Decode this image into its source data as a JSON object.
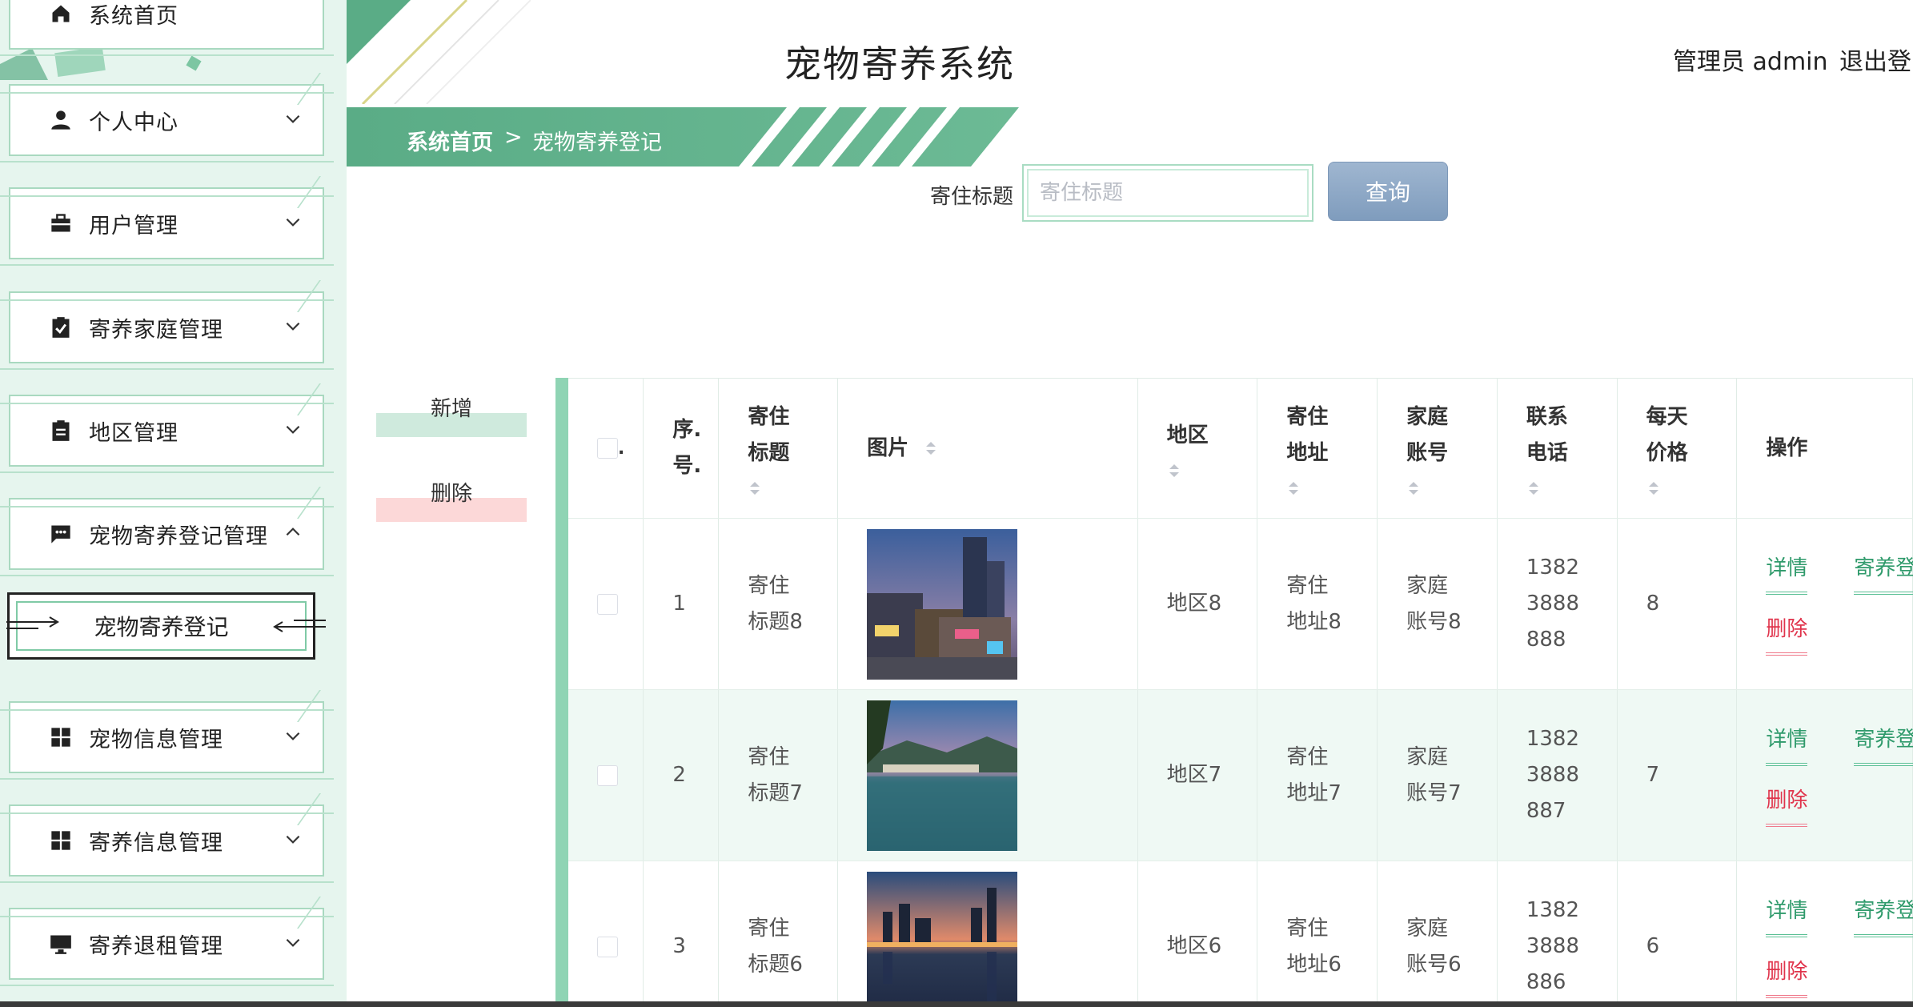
{
  "header": {
    "title": "宠物寄养系统",
    "admin_label": "管理员 admin",
    "logout_label": "退出登"
  },
  "breadcrumb": {
    "home": "系统首页",
    "separator": ">",
    "current": "宠物寄养登记"
  },
  "sidebar": {
    "items": [
      {
        "label": "系统首页",
        "icon": "home-icon"
      },
      {
        "label": "个人中心",
        "icon": "person-icon"
      },
      {
        "label": "用户管理",
        "icon": "briefcase-icon"
      },
      {
        "label": "寄养家庭管理",
        "icon": "clipboard-check-icon"
      },
      {
        "label": "地区管理",
        "icon": "clipboard-icon"
      },
      {
        "label": "宠物寄养登记管理",
        "icon": "chat-icon"
      },
      {
        "label": "宠物信息管理",
        "icon": "grid-icon"
      },
      {
        "label": "寄养信息管理",
        "icon": "grid-icon"
      },
      {
        "label": "寄养退租管理",
        "icon": "monitor-icon"
      }
    ],
    "submenu": {
      "label": "宠物寄养登记"
    }
  },
  "search": {
    "label": "寄住标题",
    "placeholder": "寄住标题",
    "button": "查询"
  },
  "actions": {
    "add": "新增",
    "delete": "删除"
  },
  "table": {
    "headers": {
      "select": ".",
      "index": "序.\n号.",
      "title": "寄住\n标题",
      "image": "图片",
      "region": "地区",
      "address": "寄住\n地址",
      "family": "家庭\n账号",
      "phone": "联系\n电话",
      "price": "每天\n价格",
      "ops": "操作"
    },
    "rows": [
      {
        "index": "1",
        "title": "寄住\n标题8",
        "region": "地区8",
        "address": "寄住\n地址8",
        "family": "家庭\n账号8",
        "phone": "1382\n3888\n888",
        "price": "8",
        "image": "city-night-photo"
      },
      {
        "index": "2",
        "title": "寄住\n标题7",
        "region": "地区7",
        "address": "寄住\n地址7",
        "family": "家庭\n账号7",
        "phone": "1382\n3888\n887",
        "price": "7",
        "image": "lake-town-photo"
      },
      {
        "index": "3",
        "title": "寄住\n标题6",
        "region": "地区6",
        "address": "寄住\n地址6",
        "family": "家庭\n账号6",
        "phone": "1382\n3888\n886",
        "price": "6",
        "image": "skyline-reflection-photo"
      }
    ],
    "ops": {
      "detail": "详情",
      "delete": "删除",
      "register": "寄养登"
    }
  },
  "colors": {
    "accent": "#5aac86",
    "sidebar_bg": "#e6f5ee",
    "query_button": "#8ea8c6",
    "delete_link": "#e0344c",
    "detail_link": "#2f9a6b"
  }
}
